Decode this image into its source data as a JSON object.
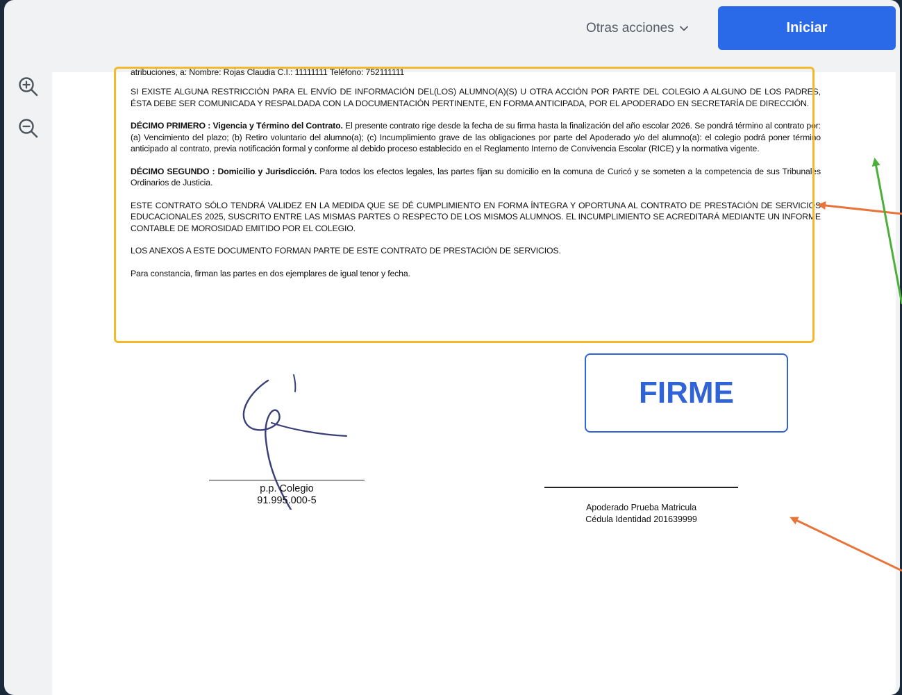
{
  "toolbar": {
    "other_actions_label": "Otras acciones",
    "start_label": "Iniciar"
  },
  "zoom": {
    "in_icon": "zoom-in-icon",
    "out_icon": "zoom-out-icon"
  },
  "document": {
    "paragraphs": [
      "atribuciones, a: Nombre: Rojas Claudia C.I.: 11111111 Teléfono: 752111111",
      "SI EXISTE ALGUNA RESTRICCIÓN PARA EL ENVÍO DE INFORMACIÓN DEL(LOS) ALUMNO(A)(S) U OTRA ACCIÓN POR PARTE DEL COLEGIO A ALGUNO DE LOS PADRES, ÉSTA DEBE SER COMUNICADA Y RESPALDADA CON LA DOCUMENTACIÓN PERTINENTE, EN FORMA ANTICIPADA, POR EL APODERADO EN SECRETARÍA DE DIRECCIÓN.",
      {
        "heading": "DÉCIMO PRIMERO  :  Vigencia y Término del Contrato.",
        "body": " El presente contrato rige desde la fecha de su firma hasta la finalización del año escolar 2026. Se pondrá término al contrato por: (a) Vencimiento del plazo; (b) Retiro voluntario del alumno(a); (c) Incumplimiento grave de las obligaciones por parte del Apoderado y/o del alumno(a): el colegio podrá poner término anticipado al contrato, previa notificación formal y conforme al debido proceso establecido en el Reglamento Interno de Convivencia Escolar (RICE) y la normativa vigente."
      },
      {
        "heading": "DÉCIMO SEGUNDO :  Domicilio y Jurisdicción.",
        "body": " Para todos los efectos legales, las partes fijan su domicilio en la comuna de Curicó y se someten a la competencia de sus Tribunales Ordinarios de Justicia."
      },
      "ESTE CONTRATO SÓLO TENDRÁ VALIDEZ EN LA MEDIDA QUE SE DÉ CUMPLIMIENTO EN FORMA ÍNTEGRA Y OPORTUNA AL CONTRATO DE PRESTACIÓN DE SERVICIOS EDUCACIONALES 2025, SUSCRITO ENTRE LAS MISMAS PARTES O RESPECTO DE LOS MISMOS ALUMNOS. EL INCUMPLIMIENTO SE ACREDITARÁ MEDIANTE UN INFORME CONTABLE DE MOROSIDAD EMITIDO POR EL COLEGIO.",
      "LOS ANEXOS A ESTE DOCUMENTO FORMAN PARTE DE ESTE CONTRATO DE PRESTACIÓN DE SERVICIOS.",
      "Para constancia, firman las partes en dos ejemplares de igual tenor y fecha."
    ]
  },
  "signatures": {
    "left_line1": "p.p. Colegio",
    "left_line2": "91.995.000-5",
    "firme_label": "FIRME",
    "right_line1": "Apoderado Prueba Matricula",
    "right_line2": "Cédula Identidad 201639999"
  },
  "colors": {
    "accent": "#2a6ae9",
    "highlight": "#f4b92a",
    "arrow_orange": "#e8743a",
    "arrow_green": "#4caf3a"
  }
}
